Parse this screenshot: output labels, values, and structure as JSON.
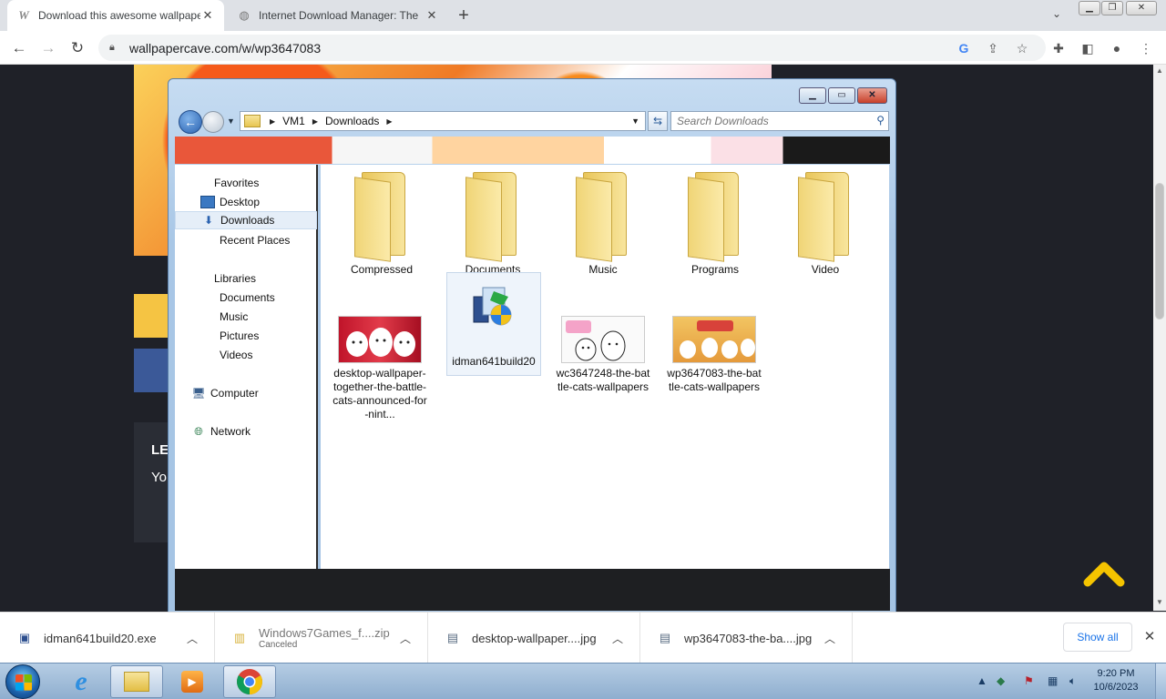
{
  "browser": {
    "tabs": [
      {
        "title": "Download this awesome wallpaper",
        "icon": "wallpapercave-icon",
        "active": true
      },
      {
        "title": "Internet Download Manager: The",
        "icon": "globe-icon",
        "active": false
      }
    ],
    "url": "wallpapercave.com/w/wp3647083"
  },
  "page": {
    "card_heading": "LE",
    "card_text": "Yo"
  },
  "explorer": {
    "breadcrumb": [
      "VM1",
      "Downloads"
    ],
    "search_placeholder": "Search Downloads",
    "nav": {
      "favorites_header": "Favorites",
      "favorites": [
        "Desktop",
        "Downloads",
        "Recent Places"
      ],
      "libraries_header": "Libraries",
      "libraries": [
        "Documents",
        "Music",
        "Pictures",
        "Videos"
      ],
      "computer": "Computer",
      "network": "Network"
    },
    "folders": [
      "Compressed",
      "Documents",
      "Music",
      "Programs",
      "Video"
    ],
    "files": [
      {
        "name": "desktop-wallpaper-together-the-battle-cats-announced-for-nint...",
        "type": "image"
      },
      {
        "name": "idman641build20",
        "type": "installer",
        "selected": true
      },
      {
        "name": "wc3647248-the-battle-cats-wallpapers",
        "type": "image"
      },
      {
        "name": "wp3647083-the-battle-cats-wallpapers",
        "type": "image"
      }
    ]
  },
  "downloads": {
    "items": [
      {
        "name": "idman641build20.exe",
        "status": ""
      },
      {
        "name": "Windows7Games_f....zip",
        "status": "Canceled"
      },
      {
        "name": "desktop-wallpaper....jpg",
        "status": ""
      },
      {
        "name": "wp3647083-the-ba....jpg",
        "status": ""
      }
    ],
    "show_all": "Show all"
  },
  "taskbar": {
    "time": "9:20 PM",
    "date": "10/6/2023"
  },
  "colors": {
    "page_bg": "#1f2128",
    "accent_yellow": "#f5c443",
    "facebook_blue": "#3b5998",
    "link_blue": "#1a73e8"
  }
}
